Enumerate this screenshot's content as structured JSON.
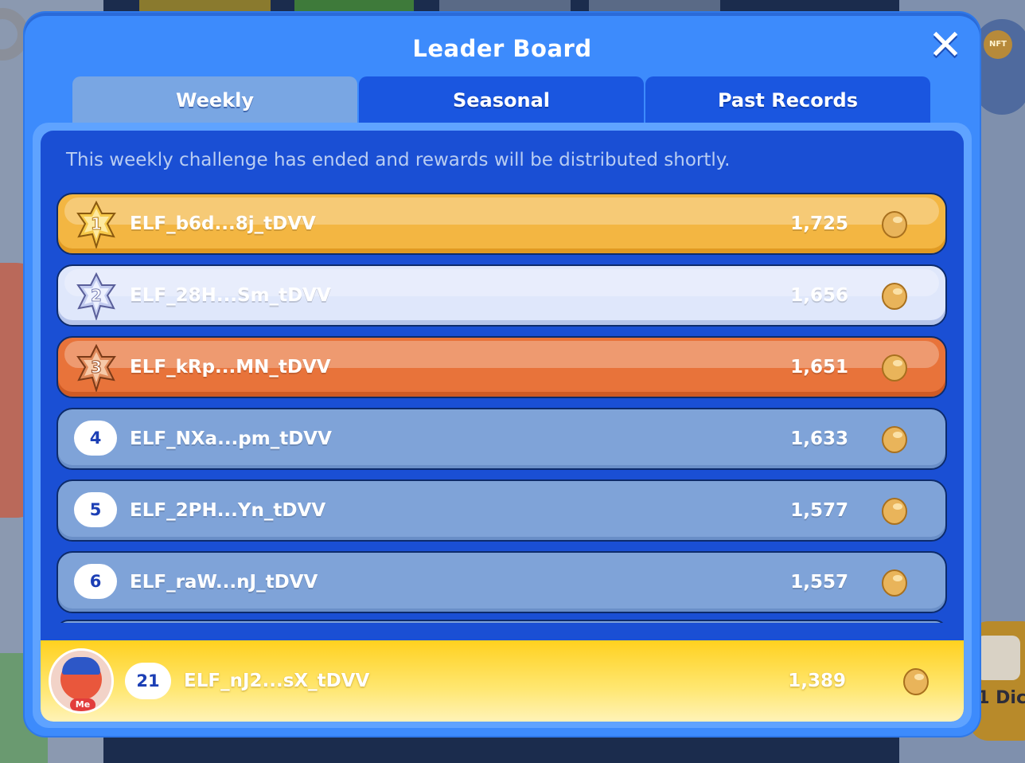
{
  "header": {
    "title": "Leader Board",
    "close_label": "✕"
  },
  "tabs": [
    {
      "label": "Weekly",
      "active": true
    },
    {
      "label": "Seasonal",
      "active": false
    },
    {
      "label": "Past Records",
      "active": false
    }
  ],
  "notice": "This weekly challenge has ended and rewards will be distributed shortly.",
  "leaderboard": [
    {
      "rank": "1",
      "name": "ELF_b6d...8j_tDVV",
      "score": "1,725",
      "icon": "gold-medal-icon",
      "style": "gold"
    },
    {
      "rank": "2",
      "name": "ELF_28H...Sm_tDVV",
      "score": "1,656",
      "icon": "silver-medal-icon",
      "style": "silver"
    },
    {
      "rank": "3",
      "name": "ELF_kRp...MN_tDVV",
      "score": "1,651",
      "icon": "bronze-medal-icon",
      "style": "bronze"
    },
    {
      "rank": "4",
      "name": "ELF_NXa...pm_tDVV",
      "score": "1,633",
      "style": "plain"
    },
    {
      "rank": "5",
      "name": "ELF_2PH...Yn_tDVV",
      "score": "1,577",
      "style": "plain"
    },
    {
      "rank": "6",
      "name": "ELF_raW...nJ_tDVV",
      "score": "1,557",
      "style": "plain"
    }
  ],
  "me": {
    "tag": "Me",
    "rank": "21",
    "name": "ELF_nJ2...sX_tDVV",
    "score": "1,389"
  },
  "background": {
    "shop_badge": "NFT",
    "dice_label": "1 Dic"
  },
  "colors": {
    "modal_bg": "#3d8bfc",
    "panel_bg": "#1a4fd4",
    "gold": "#f3b642",
    "silver": "#dfe7fb",
    "bronze": "#e8733a",
    "row_plain": "#7fa3d8",
    "me_bar": "#ffd11f",
    "bean": "#e9b45a"
  }
}
